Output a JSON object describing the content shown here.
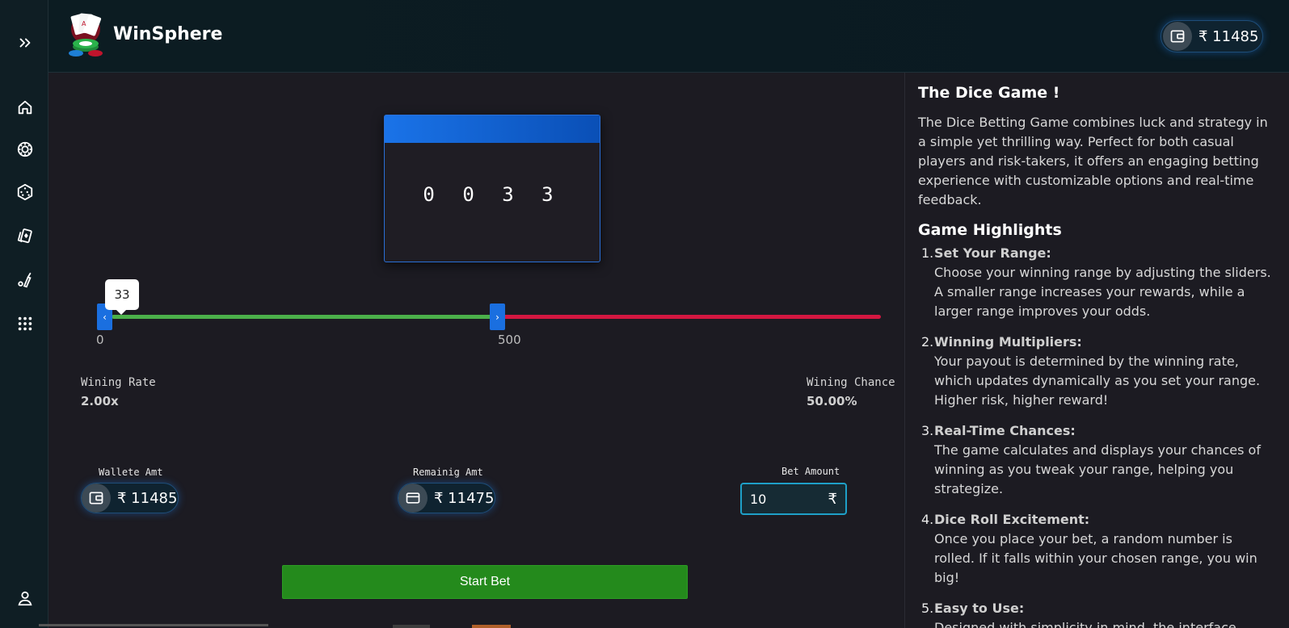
{
  "brand": {
    "name": "WinSphere",
    "logo_icon": "playing-cards-chips-logo"
  },
  "header": {
    "wallet_amount": "₹ 11485",
    "wallet_icon": "wallet-icon"
  },
  "sidebar": {
    "items": [
      {
        "icon": "expand-chevrons-icon"
      },
      {
        "icon": "home-icon"
      },
      {
        "icon": "roulette-chip-icon"
      },
      {
        "icon": "dice-icon"
      },
      {
        "icon": "cards-icon"
      },
      {
        "icon": "cricket-icon"
      },
      {
        "icon": "grid-menu-icon"
      },
      {
        "icon": "user-icon"
      }
    ]
  },
  "game": {
    "dice_digits": "0 0 3 3",
    "slider": {
      "min_label": "0",
      "mid_label": "500",
      "tooltip_value": "33",
      "low_fraction": 0.0,
      "high_fraction": 0.5,
      "win_color": "#4bb04a",
      "lose_color": "#d41741"
    },
    "win_rate_label": "Wining Rate",
    "win_rate_value": "2.00x",
    "win_chance_label": "Wining Chance",
    "win_chance_value": "50.00%",
    "wallet_label": "Wallete Amt",
    "wallet_value": "₹ 11485",
    "remaining_label": "Remainig Amt",
    "remaining_value": "₹ 11475",
    "bet_label": "Bet Amount",
    "bet_value": "10",
    "bet_currency": "₹",
    "start_button": "Start Bet"
  },
  "info": {
    "title": "The Dice Game !",
    "description": "The Dice Betting Game combines luck and strategy in a simple yet thrilling way. Perfect for both casual players and risk-takers, it offers an engaging betting experience with customizable options and real-time feedback.",
    "highlights_title": "Game Highlights",
    "highlights": [
      {
        "num": "1.",
        "title": "Set Your Range:",
        "text": "Choose your winning range by adjusting the sliders. A smaller range increases your rewards, while a larger range improves your odds."
      },
      {
        "num": "2.",
        "title": "Winning Multipliers:",
        "text": "Your payout is determined by the winning rate, which updates dynamically as you set your range. Higher risk, higher reward!"
      },
      {
        "num": "3.",
        "title": "Real-Time Chances:",
        "text": "The game calculates and displays your chances of winning as you tweak your range, helping you strategize."
      },
      {
        "num": "4.",
        "title": "Dice Roll Excitement:",
        "text": "Once you place your bet, a random number is rolled. If it falls within your chosen range, you win big!"
      },
      {
        "num": "5.",
        "title": "Easy to Use:",
        "text": "Designed with simplicity in mind, the interface"
      }
    ]
  }
}
